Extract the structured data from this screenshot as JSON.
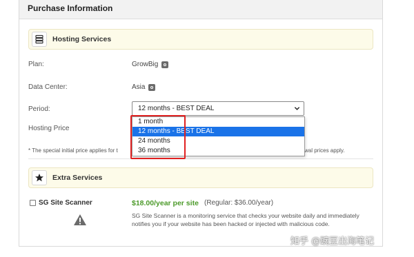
{
  "panel": {
    "title": "Purchase Information"
  },
  "hosting": {
    "section_label": "Hosting Services",
    "icon": "server-icon",
    "plan_label": "Plan:",
    "plan_value": "GrowBig",
    "datacenter_label": "Data Center:",
    "datacenter_value": "Asia",
    "period_label": "Period:",
    "period_selected": "12 months - BEST DEAL",
    "period_options": [
      "1 month",
      "12 months - BEST DEAL",
      "24 months",
      "36 months"
    ],
    "price_label": "Hosting Price",
    "note": "* The special initial price applies for t",
    "note_tail": "wal prices apply."
  },
  "extra": {
    "section_label": "Extra Services",
    "icon": "star-icon",
    "service_name": "SG Site Scanner",
    "service_checked": false,
    "price": "$18.00/year per site",
    "regular": "(Regular: $36.00/year)",
    "description": "SG Site Scanner is a monitoring service that checks your website daily and immediately notifies you if your website has been hacked or injected with malicious code."
  },
  "watermark": "知乎 @豌豆出海笔记",
  "colors": {
    "accent": "#1a73e8",
    "highlight": "#e02020",
    "price": "#4c9a2a",
    "section_bg": "#fdfbe9"
  }
}
